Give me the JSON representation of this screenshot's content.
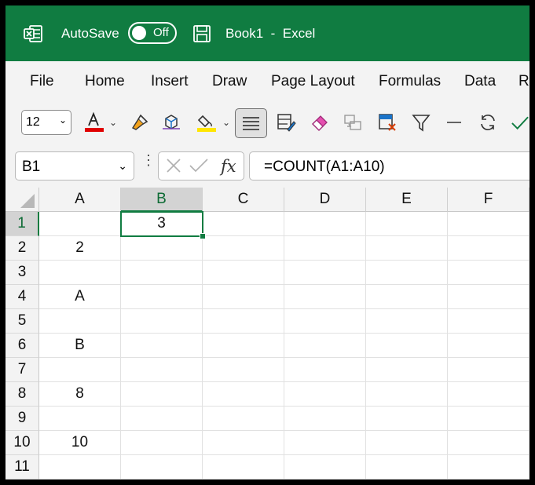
{
  "title_bar": {
    "autosave_label": "AutoSave",
    "autosave_state": "Off",
    "document_title": "Book1  -  Excel"
  },
  "ribbon_tabs": [
    "File",
    "Home",
    "Insert",
    "Draw",
    "Page Layout",
    "Formulas",
    "Data",
    "Re"
  ],
  "toolbar": {
    "font_size": "12",
    "font_color": "#e00000",
    "highlight_color": "#ffe600"
  },
  "formula_bar": {
    "name_box": "B1",
    "formula": "=COUNT(A1:A10)"
  },
  "sheet": {
    "columns": [
      "A",
      "B",
      "C",
      "D",
      "E",
      "F"
    ],
    "rows": [
      "1",
      "2",
      "3",
      "4",
      "5",
      "6",
      "7",
      "8",
      "9",
      "10",
      "11"
    ],
    "cells": {
      "A2": "2",
      "A4": "A",
      "A6": "B",
      "A8": "8",
      "A10": "10",
      "B1": "3"
    },
    "selected_cell": "B1"
  },
  "colors": {
    "brand": "#107c41"
  }
}
